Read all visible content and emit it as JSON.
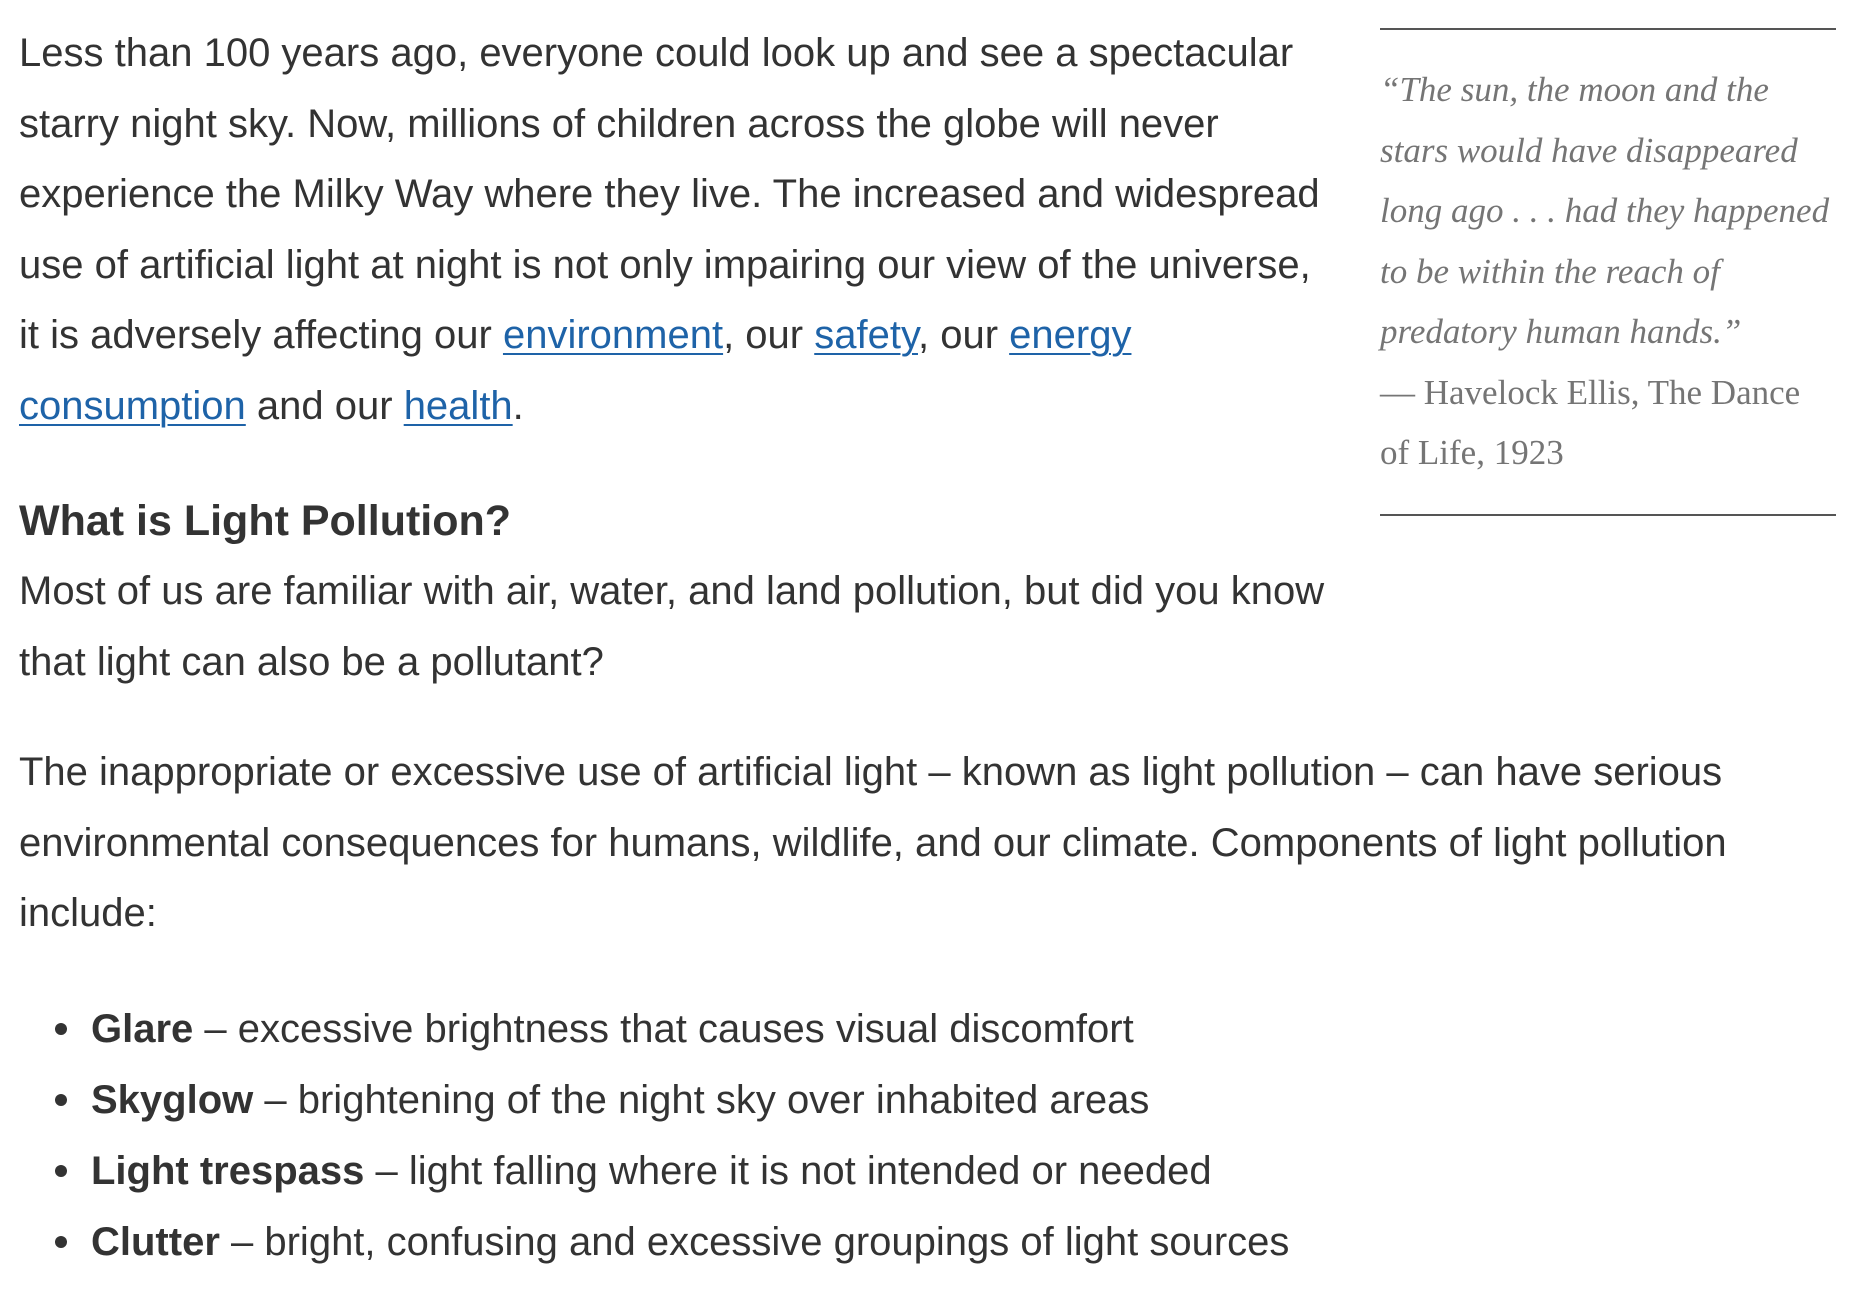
{
  "intro": {
    "text_before": "Less than 100 years ago, everyone could look up and see a spectacular starry night sky. Now, millions of children across the globe will never experience the Milky Way where they live. The increased and widespread use of artificial light at night is not only impairing our view of the universe, it is adversely affecting our ",
    "link_environment": "environment",
    "sep1": ", our ",
    "link_safety": "safety",
    "sep2": ", our ",
    "link_energy": "energy consumption",
    "sep3": " and our ",
    "link_health": "health",
    "end": "."
  },
  "quote": {
    "text": "“The sun, the moon and the stars would have disappeared long ago . . . had they happened to be within the reach of predatory human hands.”",
    "attribution": "— Havelock Ellis, The Dance of Life, 1923"
  },
  "section": {
    "heading": "What is Light Pollution?",
    "para1": "Most of us are familiar with air, water, and land pollution, but did you know that light can also be a pollutant?",
    "para2": "The inappropriate or excessive use of artificial light – known as light pollution – can have serious environmental consequences for humans, wildlife, and our climate. Components of light pollution include:"
  },
  "components": [
    {
      "term": "Glare",
      "desc": " – excessive brightness that causes visual discomfort"
    },
    {
      "term": "Skyglow",
      "desc": " – brightening of the night sky over inhabited areas"
    },
    {
      "term": "Light trespass",
      "desc": " – light falling where it is not intended or needed"
    },
    {
      "term": "Clutter",
      "desc": " – bright, confusing and excessive groupings of light sources"
    }
  ]
}
